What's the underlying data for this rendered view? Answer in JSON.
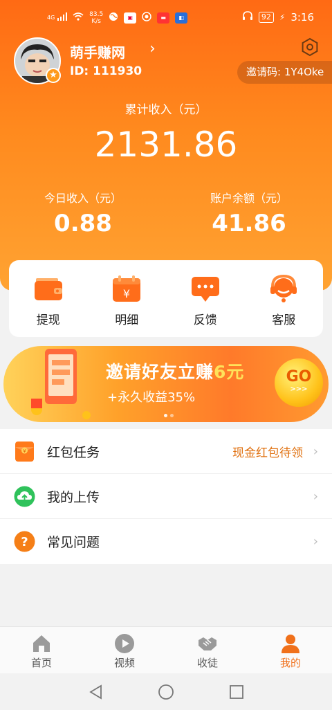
{
  "status_bar": {
    "network": "4G",
    "speed_value": "83.5",
    "speed_unit": "K/s",
    "battery": "92",
    "time": "3:16"
  },
  "profile": {
    "name": "萌手赚网",
    "id_text": "ID: 111930",
    "invite_text": "邀请码: 1Y4Oke"
  },
  "earnings": {
    "total_label": "累计收入（元）",
    "total_value": "2131.86",
    "today_label": "今日收入（元）",
    "today_value": "0.88",
    "balance_label": "账户余额（元）",
    "balance_value": "41.86"
  },
  "shortcuts": [
    {
      "label": "提现",
      "icon": "wallet-icon"
    },
    {
      "label": "明细",
      "icon": "calendar-yuan-icon"
    },
    {
      "label": "反馈",
      "icon": "chat-bubble-icon"
    },
    {
      "label": "客服",
      "icon": "headset-icon"
    }
  ],
  "banner": {
    "title_main": "邀请好友立赚",
    "title_highlight": "6元",
    "subtitle": "+永久收益35%",
    "go_label": "GO",
    "go_arrows": ">>>"
  },
  "menu": [
    {
      "label": "红包任务",
      "extra": "现金红包待领",
      "icon": "red-envelope-icon"
    },
    {
      "label": "我的上传",
      "extra": "",
      "icon": "cloud-upload-icon"
    },
    {
      "label": "常见问题",
      "extra": "",
      "icon": "question-icon"
    }
  ],
  "bottom_nav": [
    {
      "label": "首页",
      "icon": "home-icon",
      "active": false
    },
    {
      "label": "视频",
      "icon": "play-icon",
      "active": false
    },
    {
      "label": "收徒",
      "icon": "handshake-icon",
      "active": false
    },
    {
      "label": "我的",
      "icon": "person-icon",
      "active": true
    }
  ],
  "colors": {
    "brand_orange": "#ff7a1a",
    "accent_text": "#e0700f",
    "active_tab": "#f0701a"
  }
}
